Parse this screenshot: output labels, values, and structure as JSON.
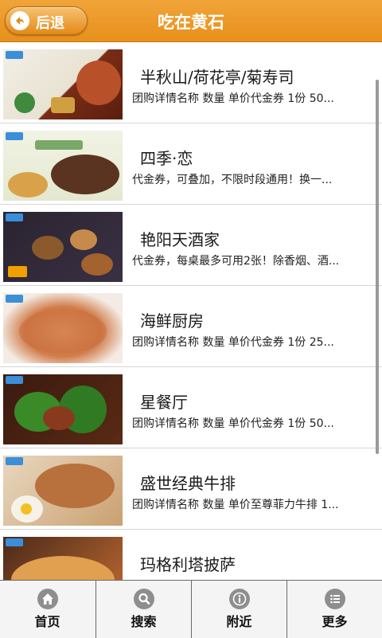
{
  "header": {
    "back_label": "后退",
    "title": "吃在黄石"
  },
  "items": [
    {
      "title": "半秋山/荷花亭/菊寿司",
      "desc": "团购详情名称 数量 单价代金券 1份 50..."
    },
    {
      "title": "四季·恋",
      "desc": "代金券，可叠加，不限时段通用！换一..."
    },
    {
      "title": "艳阳天酒家",
      "desc": "代金券，每桌最多可用2张！除香烟、酒..."
    },
    {
      "title": "海鲜厨房",
      "desc": "团购详情名称 数量 单价代金券 1份 25..."
    },
    {
      "title": "星餐厅",
      "desc": "团购详情名称 数量 单价代金券 1份 50..."
    },
    {
      "title": "盛世经典牛排",
      "desc": "团购详情名称 数量 单价至尊菲力牛排 1..."
    },
    {
      "title": "玛格利塔披萨",
      "desc": ""
    }
  ],
  "tabs": [
    {
      "label": "首页",
      "icon": "home-icon"
    },
    {
      "label": "搜索",
      "icon": "search-icon"
    },
    {
      "label": "附近",
      "icon": "info-icon"
    },
    {
      "label": "更多",
      "icon": "list-icon"
    }
  ],
  "colors": {
    "header": "#e8901c",
    "tab_icon": "#8e8e8e"
  }
}
